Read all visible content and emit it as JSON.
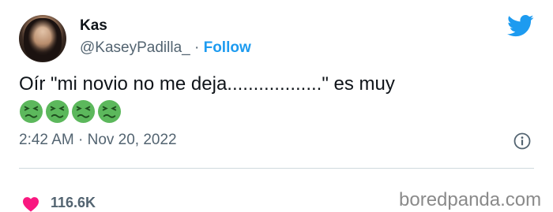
{
  "tweet": {
    "author": {
      "name": "Kas",
      "handle": "@KaseyPadilla_"
    },
    "follow_separator": " · ",
    "follow_label": "Follow",
    "text": "Oír \"mi novio no me deja..................\" es muy",
    "emoji": [
      "nauseated-face-emoji",
      "nauseated-face-emoji",
      "nauseated-face-emoji",
      "nauseated-face-emoji"
    ],
    "timestamp": "2:42 AM · Nov 20, 2022",
    "likes": "116.6K"
  },
  "watermark": "boredpanda.com",
  "colors": {
    "accent": "#1d9bf0",
    "heart": "#f91880",
    "emoji": "#5cb85c",
    "muted": "#536471"
  },
  "icons": [
    "twitter-bird-icon",
    "info-icon",
    "heart-icon"
  ]
}
